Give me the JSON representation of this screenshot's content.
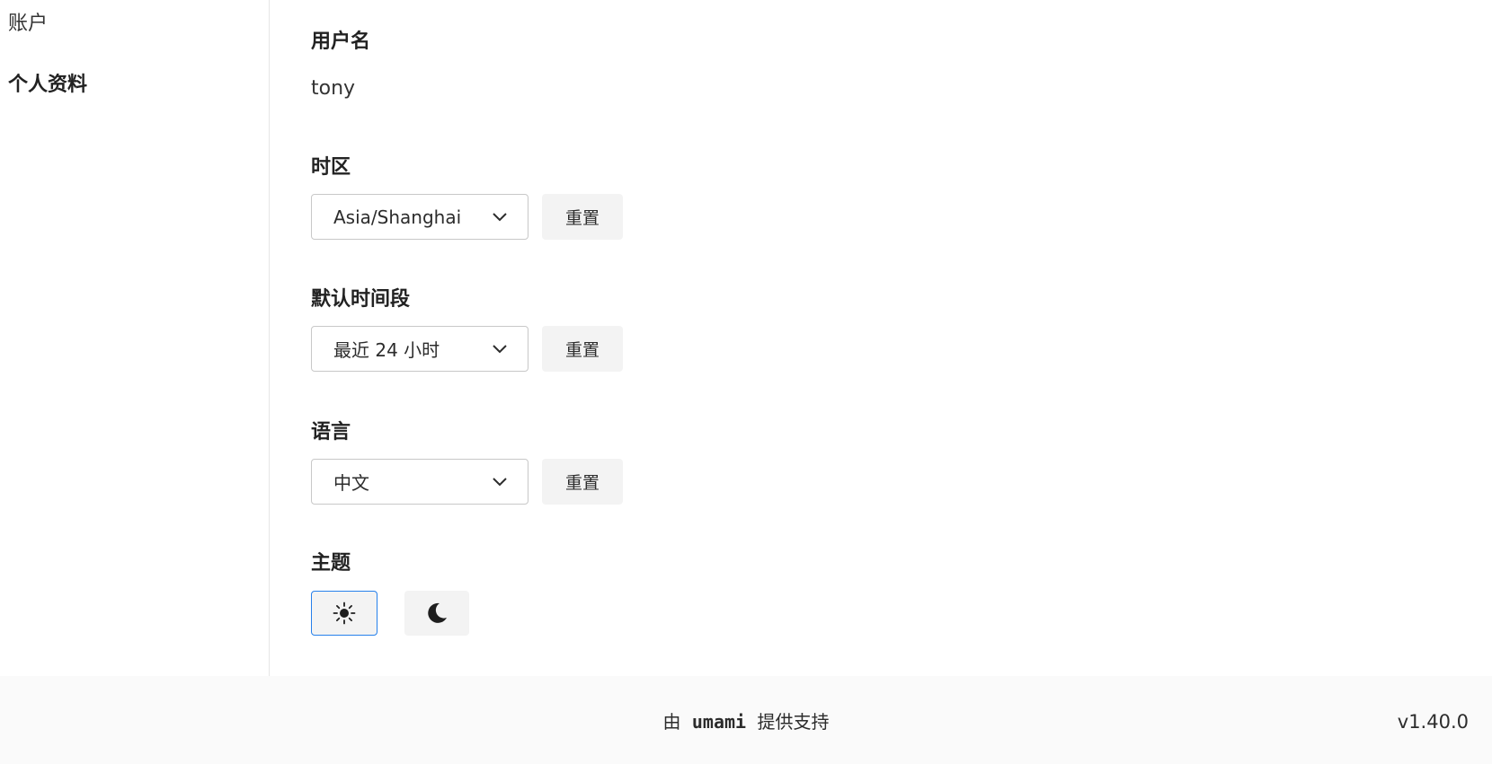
{
  "sidebar": {
    "items": [
      {
        "label": "账户"
      },
      {
        "label": "个人资料"
      }
    ]
  },
  "profile": {
    "username_label": "用户名",
    "username_value": "tony",
    "timezone_label": "时区",
    "timezone_value": "Asia/Shanghai",
    "date_range_label": "默认时间段",
    "date_range_value": "最近 24 小时",
    "language_label": "语言",
    "language_value": "中文",
    "theme_label": "主题",
    "reset_label": "重置",
    "theme_selected": "light"
  },
  "footer": {
    "prefix": "由",
    "brand": "umami",
    "suffix": "提供支持",
    "version": "v1.40.0"
  },
  "colors": {
    "accent": "#2680eb",
    "button_bg": "#f3f3f3",
    "footer_bg": "#fafafa"
  },
  "icons": {
    "light_theme": "sun-icon",
    "dark_theme": "moon-icon",
    "select_arrow": "chevron-down-icon"
  }
}
